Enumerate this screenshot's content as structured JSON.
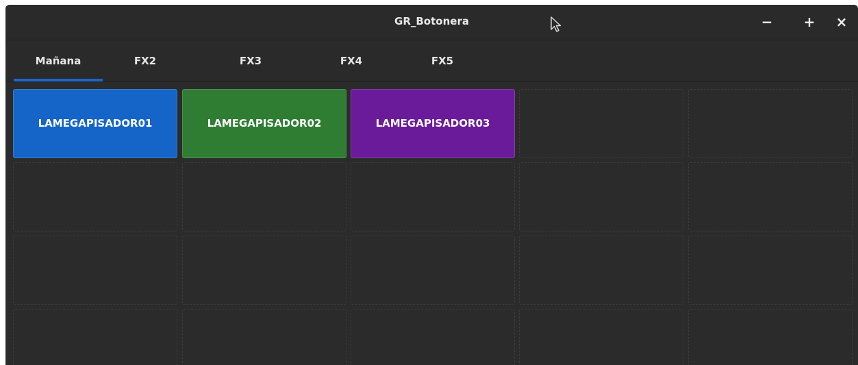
{
  "window": {
    "title": "GR_Botonera",
    "minimize_label": "−",
    "maximize_label": "+",
    "close_label": "×"
  },
  "tabs": [
    {
      "label": "Mañana",
      "active": true
    },
    {
      "label": "FX2",
      "active": false
    },
    {
      "label": "FX3",
      "active": false
    },
    {
      "label": "FX4",
      "active": false
    },
    {
      "label": "FX5",
      "active": false
    }
  ],
  "buttons": [
    {
      "label": "LAMEGAPISADOR01",
      "color": "#1565c8"
    },
    {
      "label": "LAMEGAPISADOR02",
      "color": "#2e7d32"
    },
    {
      "label": "LAMEGAPISADOR03",
      "color": "#6a1b9a"
    }
  ],
  "colors": {
    "background": "#2b2b2b",
    "accent": "#1e66c8"
  }
}
